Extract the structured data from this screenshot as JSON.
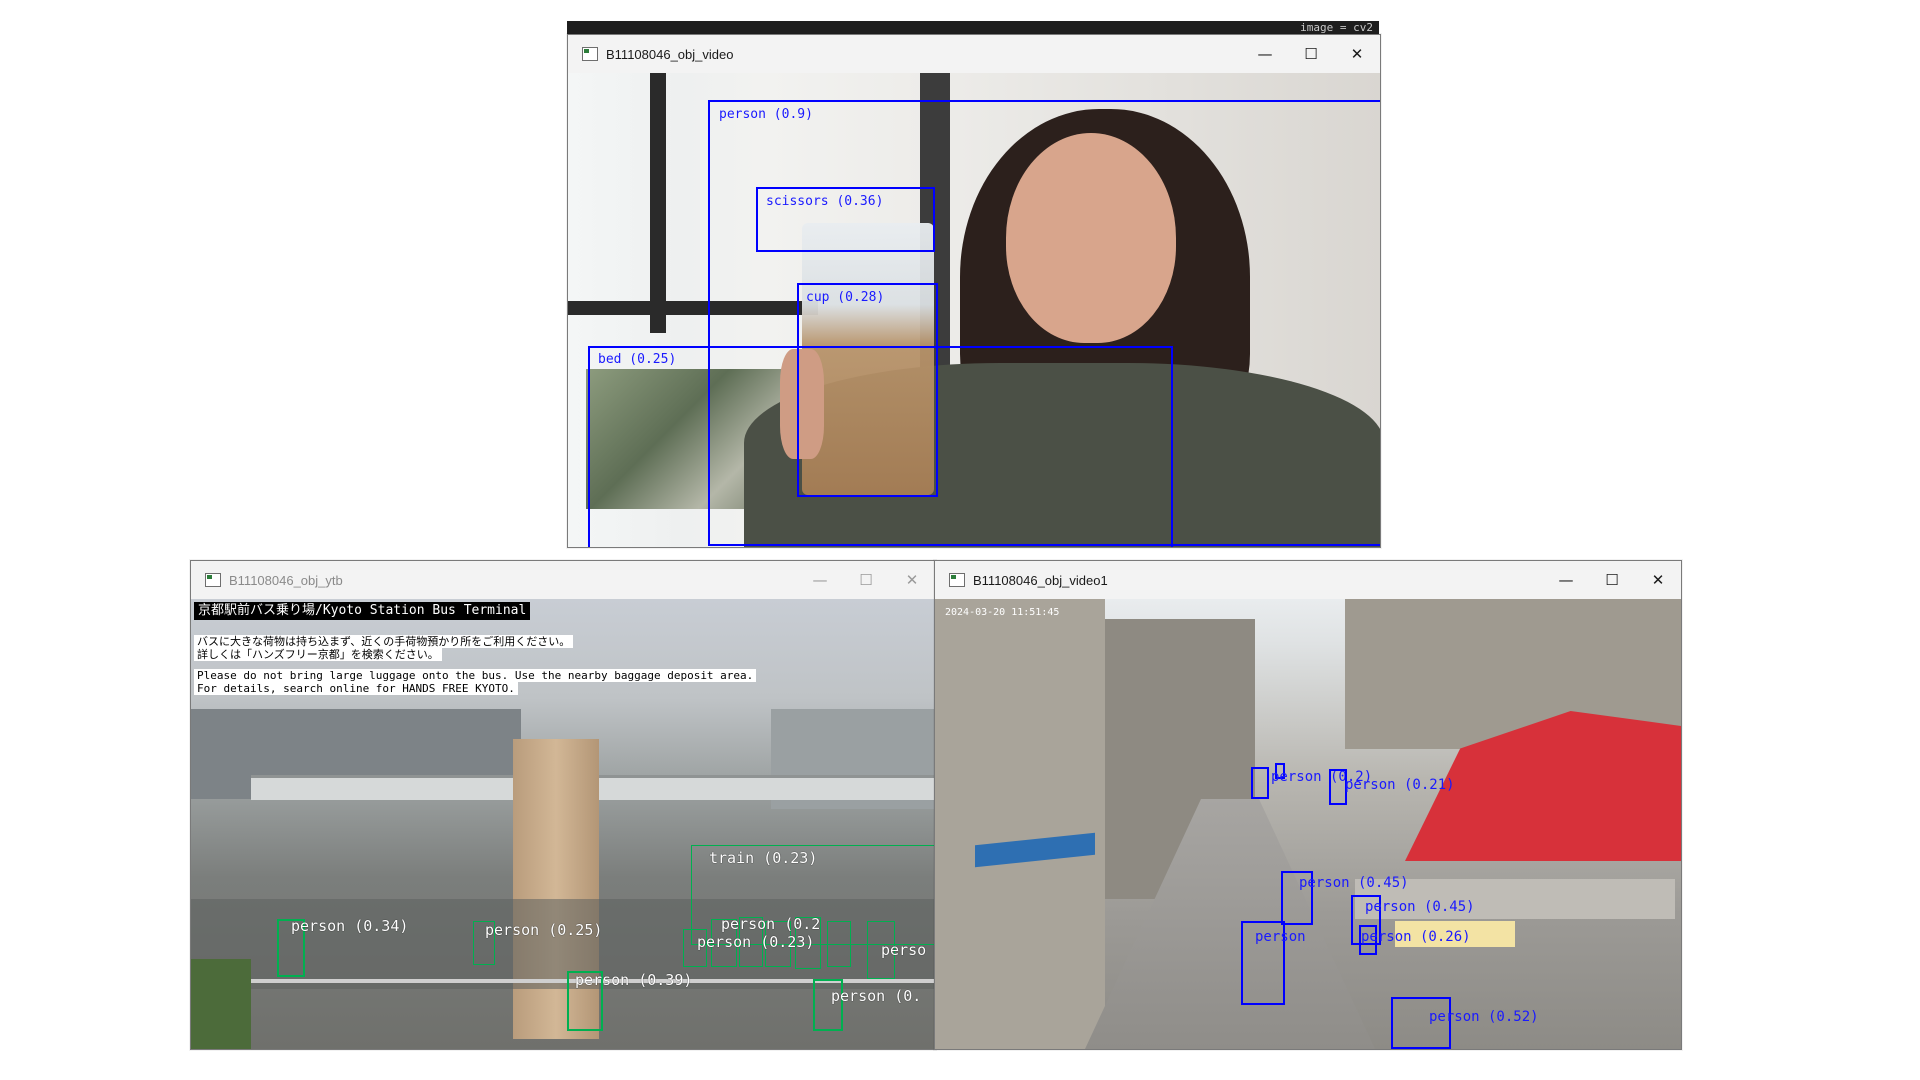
{
  "windows": {
    "video": {
      "title": "B11108046_obj_video",
      "controls": {
        "minimize": "—",
        "maximize": "☐",
        "close": "✕"
      },
      "peek_text": "image = cv2",
      "detections": [
        {
          "label": "person (0.9)"
        },
        {
          "label": "scissors (0.36)"
        },
        {
          "label": "cup (0.28)"
        },
        {
          "label": "bed (0.25)"
        }
      ]
    },
    "ytb": {
      "title": "B11108046_obj_ytb",
      "controls": {
        "minimize": "—",
        "maximize": "☐",
        "close": "✕"
      },
      "banner": {
        "title": "京都駅前バス乗り場/Kyoto Station Bus Terminal",
        "jp_line1": "バスに大きな荷物は持ち込まず、近くの手荷物預かり所をご利用ください。",
        "jp_line2": "詳しくは「ハンズフリー京都」を検索ください。",
        "en_line1": "Please do not bring large luggage onto the bus. Use the nearby baggage deposit area.",
        "en_line2": "For details, search online for HANDS FREE KYOTO."
      },
      "detections": [
        {
          "label": "person (0.34)"
        },
        {
          "label": "person (0.25)"
        },
        {
          "label": "person (0.39)"
        },
        {
          "label": "train (0.23)"
        },
        {
          "label": "person (0.23)"
        },
        {
          "label": "person (0.2"
        },
        {
          "label": "perso"
        },
        {
          "label": "person (0."
        }
      ]
    },
    "video1": {
      "title": "B11108046_obj_video1",
      "controls": {
        "minimize": "—",
        "maximize": "☐",
        "close": "✕"
      },
      "timestamp": "2024-03-20 11:51:45",
      "detections": [
        {
          "label": "person (0.2)"
        },
        {
          "label": "person (0.21)"
        },
        {
          "label": "person (0.45)"
        },
        {
          "label": "person (0.45)"
        },
        {
          "label": "person"
        },
        {
          "label": "person (0.26)"
        },
        {
          "label": "person (0.52)"
        }
      ]
    }
  },
  "colors": {
    "detection_blue": "#0000ff",
    "detection_green": "#00b050",
    "titlebar_bg": "#f3f3f3"
  }
}
